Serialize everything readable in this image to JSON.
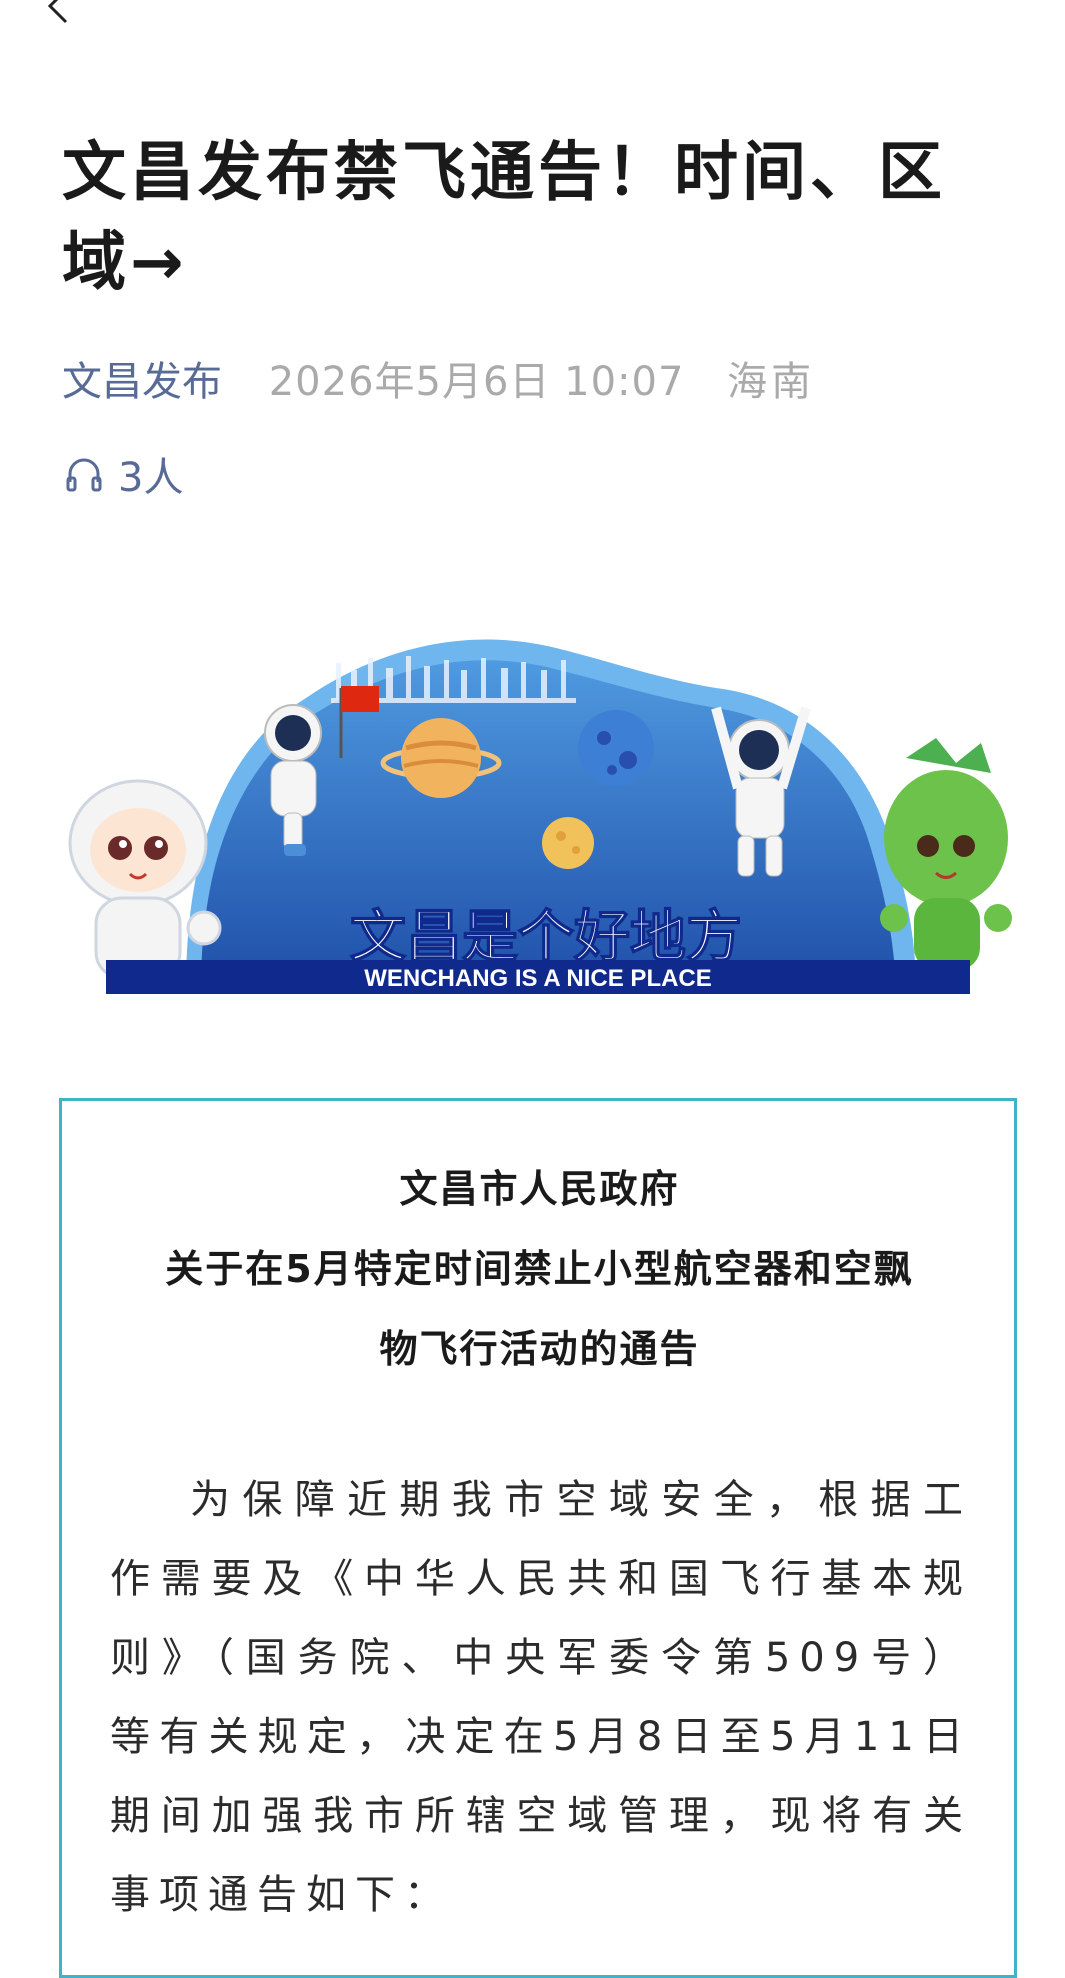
{
  "article": {
    "title": "文昌发布禁飞通告！时间、区域→",
    "account": "文昌发布",
    "date": "2026年5月6日 10:07",
    "region": "海南",
    "listen_count": "3人"
  },
  "banner": {
    "slogan_cn": "文昌是个好地方",
    "slogan_en": "WENCHANG IS A NICE PLACE"
  },
  "notice": {
    "issuer": "文昌市人民政府",
    "heading_line1": "关于在5月特定时间禁止小型航空器和空飘",
    "heading_line2": "物飞行活动的通告",
    "body": "为保障近期我市空域安全，根据工作需要及《中华人民共和国飞行基本规则》（国务院、中央军委令第509号）等有关规定，决定在5月8日至5月11日期间加强我市所辖空域管理，现将有关事项通告如下："
  },
  "colors": {
    "account_link": "#576b95",
    "meta_gray": "#aaaaaa",
    "notice_border": "#3fb4c8",
    "banner_blue": "#2a64b8",
    "banner_navy": "#0f2a8c"
  },
  "icons": {
    "back": "back-arrow-icon",
    "more": "more-dots-icon",
    "listen": "headphones-icon"
  }
}
